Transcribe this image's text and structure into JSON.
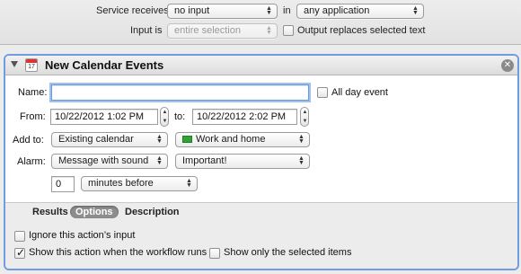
{
  "service_bar": {
    "receives_label": "Service receives",
    "receives_value": "no input",
    "in_label": "in",
    "app_value": "any application",
    "input_is_label": "Input is",
    "input_is_value": "entire selection",
    "replaces_label": "Output replaces selected text",
    "replaces_checked": false
  },
  "action": {
    "title": "New Calendar Events",
    "icon_day": "17",
    "name_label": "Name:",
    "name_value": "",
    "all_day_label": "All day event",
    "all_day_checked": false,
    "from_label": "From:",
    "from_value": "10/22/2012   1:02 PM",
    "to_label": "to:",
    "to_value": "10/22/2012   2:02 PM",
    "add_to_label": "Add to:",
    "add_to_value": "Existing calendar",
    "calendar_value": "Work and home",
    "calendar_color": "#2fa336",
    "alarm_label": "Alarm:",
    "alarm_value": "Message with sound",
    "sound_value": "Important!",
    "alarm_count": "0",
    "alarm_unit": "minutes before"
  },
  "tabs": [
    {
      "label": "Results",
      "selected": false
    },
    {
      "label": "Options",
      "selected": true
    },
    {
      "label": "Description",
      "selected": false
    }
  ],
  "options": {
    "ignore_input_label": "Ignore this action’s input",
    "ignore_input_checked": false,
    "show_when_runs_label": "Show this action when the workflow runs",
    "show_when_runs_checked": true,
    "show_selected_label": "Show only the selected items",
    "show_selected_checked": false
  },
  "colors": {
    "panel_border": "#6f9de0",
    "focus_ring": "#9ec1ee"
  }
}
